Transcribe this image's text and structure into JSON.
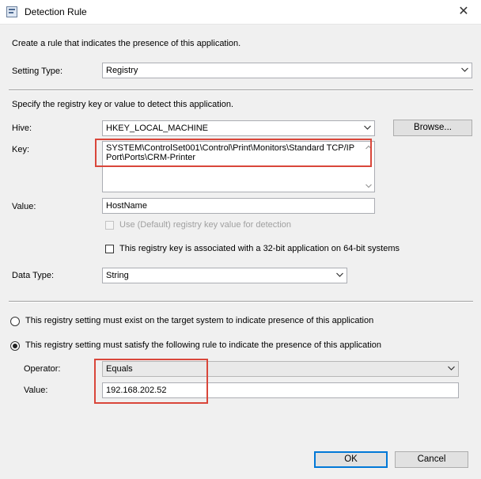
{
  "window": {
    "title": "Detection Rule",
    "close_glyph": "✕",
    "icon": "app-window-icon"
  },
  "intro_text": "Create a rule that indicates the presence of this application.",
  "setting_type": {
    "label": "Setting Type:",
    "value": "Registry"
  },
  "registry_instructions": "Specify the registry key or value to detect this application.",
  "hive": {
    "label": "Hive:",
    "value": "HKEY_LOCAL_MACHINE",
    "browse_label": "Browse..."
  },
  "key": {
    "label": "Key:",
    "line1": "SYSTEM\\ControlSet001\\Control\\Print\\Monitors\\Standard TCP/IP",
    "line2": "Port\\Ports\\CRM-Printer"
  },
  "value": {
    "label": "Value:",
    "value": "HostName"
  },
  "use_default_checkbox": {
    "label": "Use (Default) registry key value for detection",
    "checked": false,
    "enabled": false
  },
  "bit32_checkbox": {
    "label": "This registry key is associated with a 32-bit application on 64-bit systems",
    "checked": false
  },
  "data_type": {
    "label": "Data Type:",
    "value": "String"
  },
  "radio_exist": {
    "label": "This registry setting must exist on the target system to indicate presence of this application",
    "checked": false
  },
  "radio_rule": {
    "label": "This registry setting must satisfy the following rule to indicate the presence of this application",
    "checked": true
  },
  "operator": {
    "label": "Operator:",
    "value": "Equals"
  },
  "rule_value": {
    "label": "Value:",
    "value": "192.168.202.52"
  },
  "buttons": {
    "ok_label": "OK",
    "cancel_label": "Cancel"
  },
  "colors": {
    "highlight": "#d9463a",
    "default_button_border": "#0078d7",
    "dialog_bg": "#f0f0f0"
  }
}
